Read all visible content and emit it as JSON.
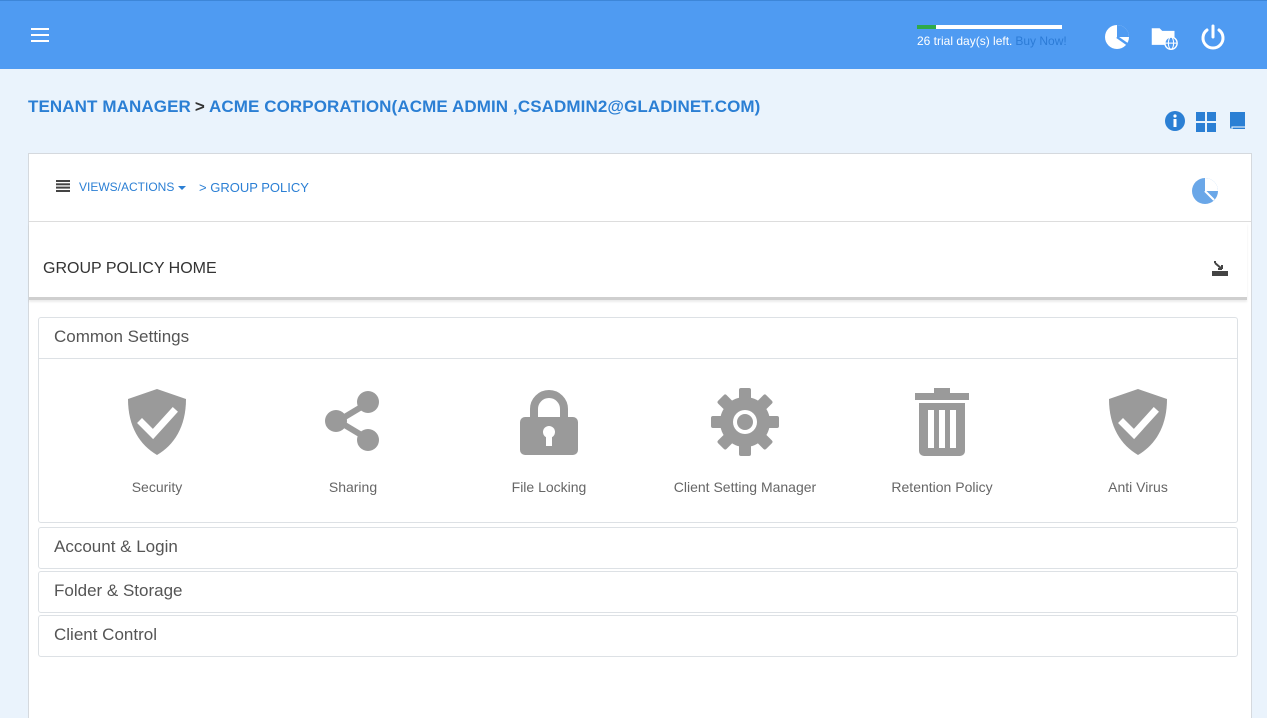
{
  "topbar": {
    "trial_text": "26 trial day(s) left.",
    "buy_now": "Buy Now!",
    "trial_progress": 0.13,
    "icons": [
      "pie-chart-icon",
      "folder-globe-icon",
      "power-icon"
    ]
  },
  "breadcrumb": {
    "root": "TENANT MANAGER",
    "separator": ">",
    "tenant": "ACME CORPORATION(ACME ADMIN ,CSADMIN2@GLADINET.COM)"
  },
  "header_icons": [
    "info-icon",
    "grid-icon",
    "book-icon"
  ],
  "panel": {
    "views_label": "VIEWS/ACTIONS",
    "crumb": "> GROUP POLICY",
    "home_title": "GROUP POLICY HOME"
  },
  "sections": {
    "common": {
      "title": "Common Settings",
      "tiles": [
        {
          "label": "Security",
          "icon": "shield-check-icon"
        },
        {
          "label": "Sharing",
          "icon": "share-icon"
        },
        {
          "label": "File Locking",
          "icon": "lock-icon"
        },
        {
          "label": "Client Setting Manager",
          "icon": "gear-icon"
        },
        {
          "label": "Retention Policy",
          "icon": "trash-icon"
        },
        {
          "label": "Anti Virus",
          "icon": "shield-check-icon"
        }
      ]
    },
    "account": {
      "title": "Account & Login"
    },
    "folder": {
      "title": "Folder & Storage"
    },
    "client": {
      "title": "Client Control"
    }
  },
  "colors": {
    "topbar": "#4f9bf2",
    "accent": "#2b7fd4",
    "icon_gray": "#9a9a9a",
    "background": "#eaf3fc"
  }
}
